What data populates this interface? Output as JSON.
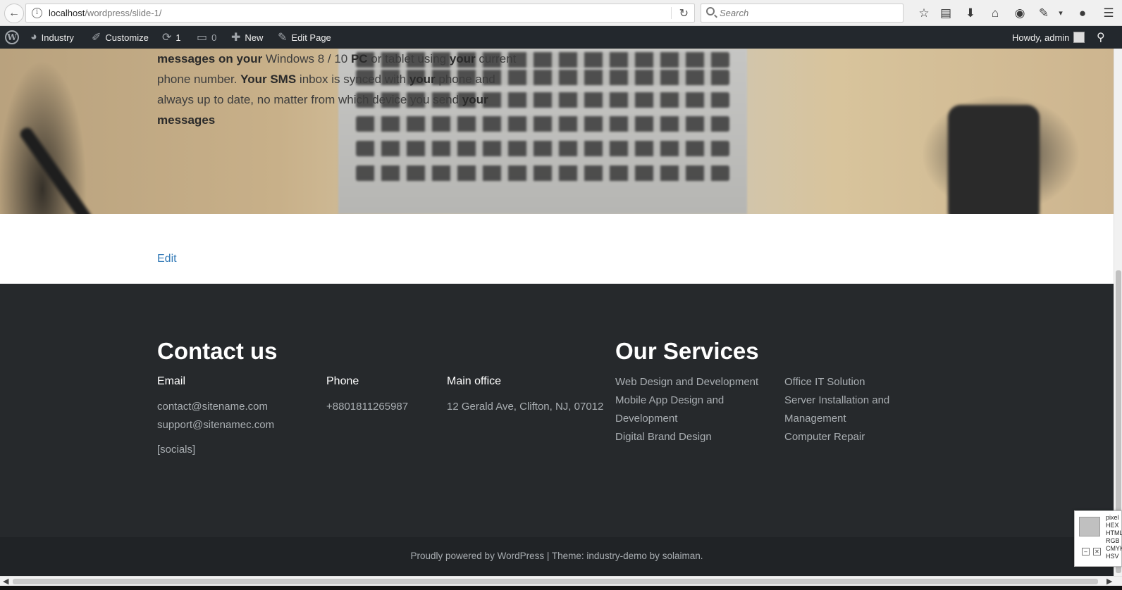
{
  "browser": {
    "back_icon": "back-arrow-icon",
    "url_host": "localhost",
    "url_path": "/wordpress/slide-1/",
    "search_placeholder": "Search",
    "toolbar_icons": [
      "bookmark-star-icon",
      "reading-list-icon",
      "download-icon",
      "home-icon",
      "pocket-icon",
      "extension-icon",
      "chat-icon",
      "menu-icon"
    ]
  },
  "admin_bar": {
    "site_name": "Industry",
    "customize": "Customize",
    "updates_count": "1",
    "comments_count": "0",
    "new": "New",
    "edit_page": "Edit Page",
    "howdy": "Howdy, admin"
  },
  "hero": {
    "line1_a": "messages on your",
    "line1_b": " Windows 8 / 10 ",
    "line1_c": "PC",
    "line1_d": " or tablet using ",
    "line1_e": "your",
    "line1_f": " current",
    "line2_a": "phone number. ",
    "line2_b": "Your SMS",
    "line2_c": " inbox is synced with ",
    "line2_d": "your",
    "line2_e": " phone and",
    "line3_a": "always up to date, no matter from which device you send ",
    "line3_b": "your",
    "line4": "messages"
  },
  "content": {
    "edit_link": "Edit"
  },
  "footer": {
    "contact_heading": "Contact us",
    "email_title": "Email",
    "email_1": "contact@sitename.com",
    "email_2": "support@sitenamec.com",
    "socials": "[socials]",
    "phone_title": "Phone",
    "phone": "+8801811265987",
    "office_title": "Main office",
    "office": "12 Gerald Ave, Clifton, NJ, 07012",
    "services_heading": "Our Services",
    "services_col1": [
      "Web Design and Development",
      "Mobile App Design and",
      "Development",
      "Digital Brand Design"
    ],
    "services_col2": [
      "Office IT Solution",
      "Server Installation and",
      "Management",
      "Computer Repair"
    ]
  },
  "copyright": {
    "prefix": "Proudly powered by ",
    "wordpress": "WordPress",
    "sep": " | Theme: industry-demo by ",
    "author": "solaiman",
    "suffix": "."
  },
  "color_picker": {
    "labels": [
      "pixel",
      "HEX",
      "HTML",
      "RGB",
      "CMYK",
      "HSV"
    ],
    "minimize": "–",
    "close": "✕"
  }
}
